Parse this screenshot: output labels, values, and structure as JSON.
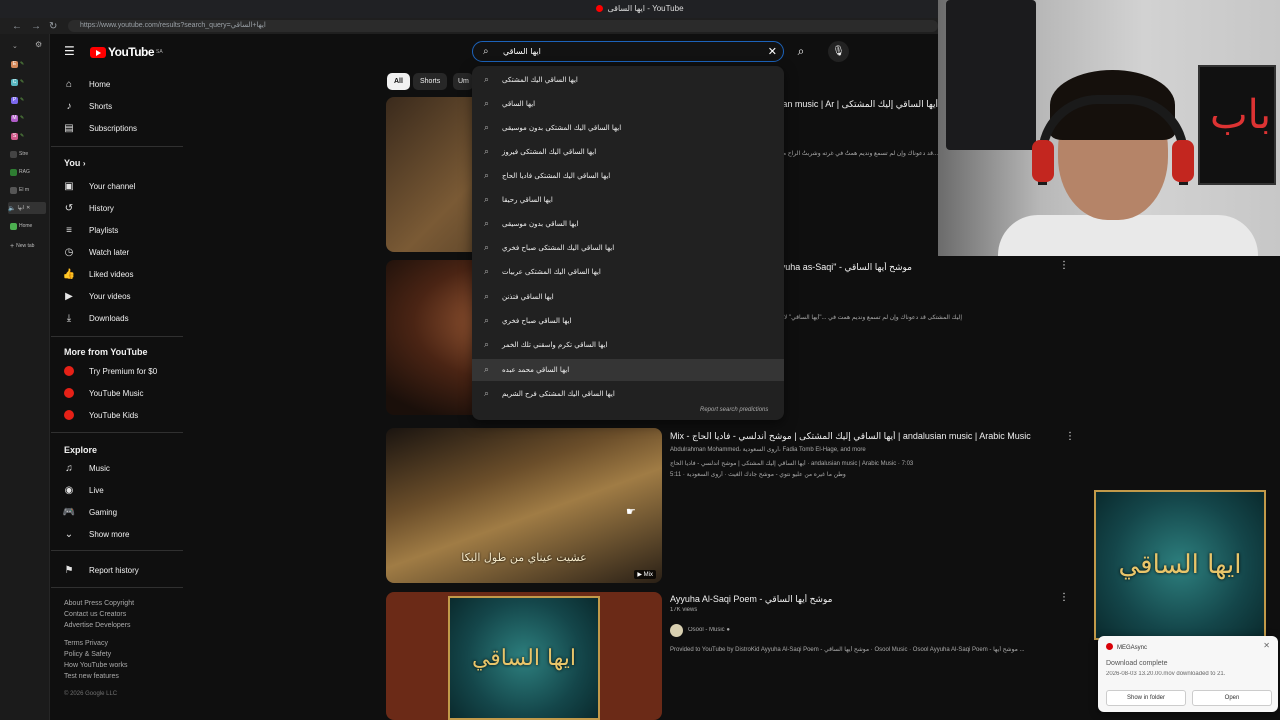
{
  "browser": {
    "tab_title": "ايها الساقى - YouTube",
    "url": "https://www.youtube.com/results?search_query=ايها+الساقي",
    "vertical_tabs": [
      {
        "label": "E"
      },
      {
        "label": "C"
      },
      {
        "label": "P"
      },
      {
        "label": "M"
      },
      {
        "label": "S"
      },
      {
        "label": "Stre"
      },
      {
        "label": "RAG"
      },
      {
        "label": "El m"
      },
      {
        "label": "ايها"
      },
      {
        "label": "Home"
      },
      {
        "label": "New tab"
      }
    ]
  },
  "header": {
    "logo_text": "YouTube",
    "logo_region": "SA",
    "search_value": "ايها الساقي"
  },
  "chips": [
    "All",
    "Shorts",
    "Um"
  ],
  "sidebar": {
    "main": [
      {
        "label": "Home",
        "icon": "home-icon"
      },
      {
        "label": "Shorts",
        "icon": "shorts-icon"
      },
      {
        "label": "Subscriptions",
        "icon": "subscriptions-icon"
      }
    ],
    "you_heading": "You",
    "you": [
      {
        "label": "Your channel",
        "icon": "channel-icon"
      },
      {
        "label": "History",
        "icon": "history-icon"
      },
      {
        "label": "Playlists",
        "icon": "playlists-icon"
      },
      {
        "label": "Watch later",
        "icon": "watch-later-icon"
      },
      {
        "label": "Liked videos",
        "icon": "like-icon"
      },
      {
        "label": "Your videos",
        "icon": "your-videos-icon"
      },
      {
        "label": "Downloads",
        "icon": "download-icon"
      }
    ],
    "more_heading": "More from YouTube",
    "more": [
      {
        "label": "Try Premium for $0"
      },
      {
        "label": "YouTube Music"
      },
      {
        "label": "YouTube Kids"
      }
    ],
    "explore_heading": "Explore",
    "explore": [
      {
        "label": "Music",
        "icon": "music-icon"
      },
      {
        "label": "Live",
        "icon": "live-icon"
      },
      {
        "label": "Gaming",
        "icon": "gaming-icon"
      },
      {
        "label": "Show more",
        "icon": "chevron-down-icon"
      }
    ],
    "report_history": "Report history",
    "footer": [
      "About  Press  Copyright",
      "Contact us  Creators",
      "Advertise  Developers",
      "",
      "Terms  Privacy",
      "Policy & Safety",
      "How YouTube works",
      "Test new features",
      "",
      "© 2026 Google LLC"
    ]
  },
  "suggestions": [
    "ايها الساقي اليك المشتكى",
    "ايها الساقي",
    "ايها الساقي اليك المشتكى بدون موسيقى",
    "ايها الساقي اليك المشتكى فيروز",
    "ايها الساقي اليك المشتكى فاديا الحاج",
    "ايها الساقي رحيقا",
    "ايها الساقي بدون موسيقى",
    "ايها الساقي اليك المشتكى صباح فخري",
    "ايها الساقي اليك المشتكى عربيات",
    "ايها الساقي فتذنن",
    "ايها الساقي صباح فخري",
    "ايها الساقي تكرم واسقني تلك الخمر",
    "ايها الساقي محمد عبده",
    "ايها الساقي اليك المشتكى فرح الشريم"
  ],
  "report_predictions": "Report search predictions",
  "results": [
    {
      "title": "أيها الساقي إليك المشتكى | andalusian music | Ar",
      "desc": "...قد دعوناك وإن لم تسمع ونديمٍ همتُ في غرته وشربتُ الراح من راحته"
    },
    {
      "title": "موشح أيها الساقي - \"Ayuha as-Saqi",
      "desc": "إليك المشتكى قد دعوناك وإن لم تسمع ونديم همت في ...\"أيها الساقي\" لابن زهر ، بسوء"
    },
    {
      "title": "Mix - أيها الساقي إليك المشتكى | موشح أندلسي - فاديا الحاج | andalusian music | Arabic Music",
      "channels": "Abdulrahman Mohammed، أروى السعودية، Fadia Tomb El-Hage, and more",
      "line1": "أيها الساقي إليك المشتكى | موشح أندلسي - فاديا الحاج · andalusian music | Arabic Music · 7:03",
      "line2": "5:11 · وطن ما غيره من عليو نتوي - موشح جادك الغيث · أروى السعودية",
      "caption": "عشيت عيناي من طول البكا",
      "badge": "Mix"
    },
    {
      "title": "Ayyuha Al-Saqi Poem - موشح أيها الساقي",
      "views": "17K views",
      "channel": "Osool - Music",
      "desc": "Provided to YouTube by DistroKid Ayyuha Al-Saqi Poem - موشح أيها الساقي · Osool Music · Osool Ayyuha Al-Saqi Poem - موشح أيها ..."
    }
  ],
  "poster_text": "ايها الساقي",
  "webcam_frame_text": "باب",
  "toast": {
    "app": "MEGAsync",
    "title": "Download complete",
    "body": "2026-08-03 13.20.00.mov downloaded to 21.",
    "btn_folder": "Show in folder",
    "btn_open": "Open"
  },
  "colors": {
    "youtube_red": "#ff0000",
    "search_border": "#1c62b9",
    "mega_red": "#d90007"
  }
}
